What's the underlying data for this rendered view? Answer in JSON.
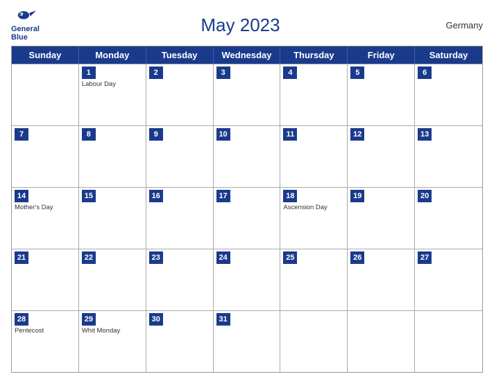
{
  "header": {
    "logo": {
      "line1": "General",
      "line2": "Blue"
    },
    "title": "May 2023",
    "country": "Germany"
  },
  "days": [
    "Sunday",
    "Monday",
    "Tuesday",
    "Wednesday",
    "Thursday",
    "Friday",
    "Saturday"
  ],
  "weeks": [
    [
      {
        "date": "",
        "event": ""
      },
      {
        "date": "1",
        "event": "Labour Day"
      },
      {
        "date": "2",
        "event": ""
      },
      {
        "date": "3",
        "event": ""
      },
      {
        "date": "4",
        "event": ""
      },
      {
        "date": "5",
        "event": ""
      },
      {
        "date": "6",
        "event": ""
      }
    ],
    [
      {
        "date": "7",
        "event": ""
      },
      {
        "date": "8",
        "event": ""
      },
      {
        "date": "9",
        "event": ""
      },
      {
        "date": "10",
        "event": ""
      },
      {
        "date": "11",
        "event": ""
      },
      {
        "date": "12",
        "event": ""
      },
      {
        "date": "13",
        "event": ""
      }
    ],
    [
      {
        "date": "14",
        "event": "Mother's Day"
      },
      {
        "date": "15",
        "event": ""
      },
      {
        "date": "16",
        "event": ""
      },
      {
        "date": "17",
        "event": ""
      },
      {
        "date": "18",
        "event": "Ascension Day"
      },
      {
        "date": "19",
        "event": ""
      },
      {
        "date": "20",
        "event": ""
      }
    ],
    [
      {
        "date": "21",
        "event": ""
      },
      {
        "date": "22",
        "event": ""
      },
      {
        "date": "23",
        "event": ""
      },
      {
        "date": "24",
        "event": ""
      },
      {
        "date": "25",
        "event": ""
      },
      {
        "date": "26",
        "event": ""
      },
      {
        "date": "27",
        "event": ""
      }
    ],
    [
      {
        "date": "28",
        "event": "Pentecost"
      },
      {
        "date": "29",
        "event": "Whit Monday"
      },
      {
        "date": "30",
        "event": ""
      },
      {
        "date": "31",
        "event": ""
      },
      {
        "date": "",
        "event": ""
      },
      {
        "date": "",
        "event": ""
      },
      {
        "date": "",
        "event": ""
      }
    ]
  ]
}
